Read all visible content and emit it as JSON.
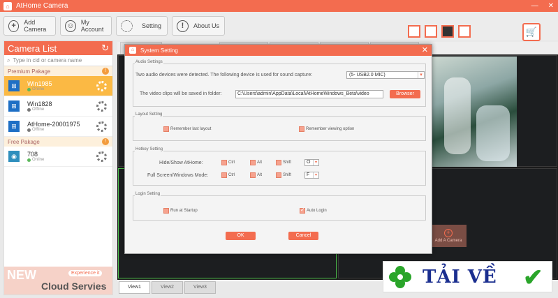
{
  "window": {
    "title": "AtHome Camera",
    "minimize": "—",
    "close": "✕"
  },
  "toolbar": {
    "add_camera": "Add Camera",
    "my_account": "My Account",
    "setting": "Setting",
    "about_us": "About Us"
  },
  "sidebar": {
    "title": "Camera List",
    "search_placeholder": "Type in cid or camera name",
    "groups": [
      {
        "label": "Premium Pakage"
      },
      {
        "label": "Free Pakage"
      }
    ],
    "cameras": [
      {
        "name": "Win1985",
        "status": "Online"
      },
      {
        "name": "Win1828",
        "status": "Offline"
      },
      {
        "name": "AtHome-20001975",
        "status": "Offline"
      },
      {
        "name": "708",
        "status": "Online"
      }
    ],
    "promo": {
      "new": "NEW",
      "experience": "Experience it",
      "cloud": "Cloud Servies"
    }
  },
  "main": {
    "first_tab": "R",
    "add_camera_tile": "Add A Camera",
    "view_tabs": [
      "View1",
      "View2",
      "View3"
    ]
  },
  "dialog": {
    "title": "System Setting",
    "audio": {
      "legend": "Audio Settings",
      "detected_text": "Two audio devices were detected.  The following device is used for sound capture:",
      "device": "(5- USB2.0 MIC)",
      "video_path_label": "The video clips will be saved in folder:",
      "video_path": "C:\\Users\\admin\\AppData\\Local\\AtHomeWindows_Beta\\video",
      "browse": "Browser"
    },
    "layout": {
      "legend": "Layout Setting",
      "remember_last": "Remember last layout",
      "remember_viewing": "Remember viewing option"
    },
    "hotkey": {
      "legend": "Hotkey Setting",
      "hide_show": "Hide/Show AtHome:",
      "fullscreen": "Full Screen/Windows Mode:",
      "ctrl": "Ctrl",
      "alt": "Alt",
      "shift": "Shift",
      "key1": "O",
      "key2": "F"
    },
    "login": {
      "legend": "Login Setting",
      "run_startup": "Run at Startup",
      "auto_login": "Auto Login"
    },
    "ok": "OK",
    "cancel": "Cancel"
  },
  "watermark": {
    "text": "TẢI VỀ"
  },
  "colors": {
    "accent": "#f36c4f",
    "selected": "#fbb944",
    "online": "#5cb85c"
  }
}
